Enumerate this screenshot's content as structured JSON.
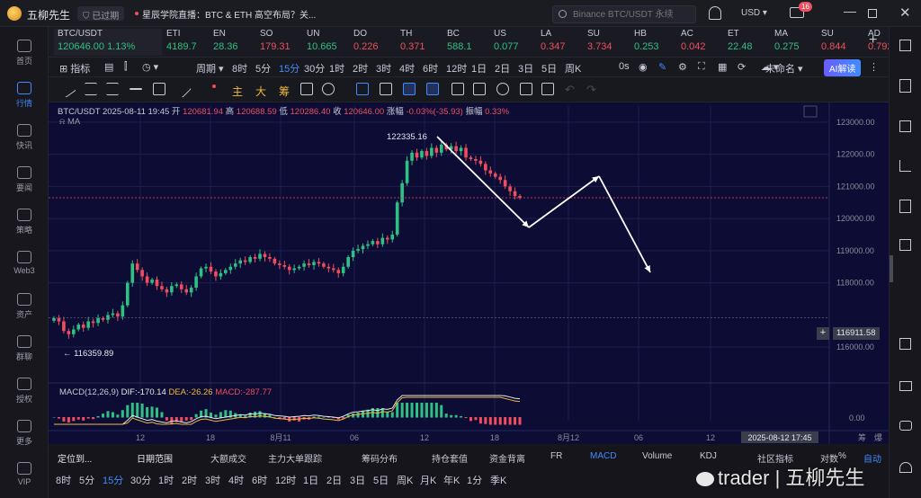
{
  "app": {
    "name": "五柳先生",
    "expired": "已过期",
    "news": "星辰学院直播：BTC & ETH 高空布局？关...",
    "search_placeholder": "Binance BTC/USDT 永续",
    "currency": "USD",
    "mail_badge": "16"
  },
  "nav": [
    {
      "label": "首页",
      "icon": "home-icon"
    },
    {
      "label": "行情",
      "icon": "chart-bars-icon",
      "active": true
    },
    {
      "label": "快讯",
      "icon": "news-icon"
    },
    {
      "label": "要闻",
      "icon": "paper-icon"
    },
    {
      "label": "策略",
      "icon": "strategy-icon"
    },
    {
      "label": "Web3",
      "icon": "web3-icon"
    },
    {
      "label": "资产",
      "icon": "wallet-icon"
    },
    {
      "label": "群聊",
      "icon": "chat-icon"
    },
    {
      "label": "授权",
      "icon": "key-icon"
    },
    {
      "label": "更多",
      "icon": "more-icon"
    },
    {
      "label": "VIP",
      "icon": "vip-icon"
    }
  ],
  "tickers": [
    {
      "sym": "BTC/USDT",
      "price": "120646.00",
      "chg": "1.13%",
      "dir": "up",
      "active": true
    },
    {
      "sym": "ETI",
      "price": "4189.7",
      "dir": "up"
    },
    {
      "sym": "EN",
      "price": "28.36",
      "dir": "up"
    },
    {
      "sym": "SO",
      "price": "179.31",
      "dir": "dn"
    },
    {
      "sym": "UN",
      "price": "10.665",
      "dir": "up"
    },
    {
      "sym": "DO",
      "price": "0.226",
      "dir": "dn"
    },
    {
      "sym": "TH",
      "price": "0.371",
      "dir": "dn"
    },
    {
      "sym": "BC",
      "price": "588.1",
      "dir": "up"
    },
    {
      "sym": "US",
      "price": "0.077",
      "dir": "up"
    },
    {
      "sym": "LA",
      "price": "0.347",
      "dir": "dn"
    },
    {
      "sym": "SU",
      "price": "3.734",
      "dir": "dn"
    },
    {
      "sym": "HB",
      "price": "0.253",
      "dir": "up"
    },
    {
      "sym": "AC",
      "price": "0.042",
      "dir": "dn"
    },
    {
      "sym": "ET",
      "price": "22.48",
      "dir": "up"
    },
    {
      "sym": "MA",
      "price": "0.275",
      "dir": "up"
    },
    {
      "sym": "SU",
      "price": "0.844",
      "dir": "dn"
    },
    {
      "sym": "AD",
      "price": "0.792",
      "dir": "dn"
    },
    {
      "sym": "LP",
      "price": "6.662",
      "dir": "up"
    }
  ],
  "toolbar1": {
    "indicator": "指标",
    "period": "周期",
    "intervals": [
      "8时",
      "5分",
      "15分",
      "30分",
      "1时",
      "2时",
      "3时",
      "4时",
      "6时",
      "12时",
      "1日",
      "2日",
      "3日",
      "5日",
      "周K"
    ],
    "active_interval": "15分",
    "right_interval": "0s",
    "unnamed": "未命名",
    "ai": "AI解读"
  },
  "toolbar2": {
    "draw_labels": [
      "主",
      "大",
      "筹"
    ]
  },
  "legend": {
    "title": "BTC/USDT 2025-08-11 19:45",
    "open_label": "开",
    "open": "120681.94",
    "high_label": "高",
    "high": "120688.59",
    "low_label": "低",
    "low": "120286.40",
    "close_label": "收",
    "close": "120646.00",
    "chg_label": "涨幅",
    "chg": "-0.03%(-35.93)",
    "amp_label": "振幅",
    "amp": "0.33%",
    "ma": "MA"
  },
  "macd": {
    "label": "MACD(12,26,9)",
    "dif": "DIF:-170.14",
    "dea": "DEA:-26.26",
    "macd": "MACD:-287.77",
    "zero": "0.00"
  },
  "chart_data": {
    "type": "candlestick",
    "y_ticks": [
      "123000.00",
      "122000.00",
      "121000.00",
      "120000.00",
      "119000.00",
      "118000.00",
      "116000.00"
    ],
    "ylim": [
      115500,
      123500
    ],
    "x_ticks": [
      "12",
      "18",
      "8月11",
      "06",
      "12",
      "18",
      "8月12",
      "06",
      "12"
    ],
    "high_annotation": "122335.16",
    "low_annotation": "116359.89",
    "current_price": "116911.58",
    "cursor_time": "2025-08-12 17:45",
    "closes": [
      116900,
      116800,
      116500,
      116400,
      116550,
      116700,
      116600,
      116800,
      116750,
      116900,
      116850,
      117000,
      117050,
      116950,
      117300,
      118000,
      118600,
      118400,
      118200,
      118000,
      118100,
      117900,
      117800,
      117700,
      117900,
      117950,
      117800,
      117700,
      117850,
      118200,
      118450,
      118500,
      118350,
      118200,
      118300,
      118400,
      118500,
      118600,
      118700,
      118650,
      118800,
      118750,
      118900,
      118800,
      118750,
      118600,
      118550,
      118500,
      118400,
      118450,
      118500,
      118600,
      118550,
      118650,
      118600,
      118500,
      118450,
      118400,
      118300,
      118500,
      118800,
      119000,
      119050,
      119150,
      119200,
      119300,
      119200,
      119400,
      119350,
      119500,
      120500,
      121100,
      121800,
      122050,
      121900,
      122100,
      121950,
      122200,
      122050,
      122300,
      122150,
      122250,
      122100,
      122200,
      121900,
      121850,
      121800,
      121700,
      121500,
      121400,
      121300,
      121200,
      121000,
      120850,
      120700,
      120646
    ],
    "projection": [
      [
        122335,
        0
      ],
      [
        119950,
        6
      ],
      [
        121300,
        16
      ],
      [
        118800,
        22
      ]
    ],
    "ylabels_right": [
      "筹",
      "爆"
    ]
  },
  "bottom": {
    "tabs1": [
      "定位到...",
      "日期范围"
    ],
    "tabs2": [
      "大额成交",
      "主力大单跟踪",
      "筹码分布",
      "持仓套值",
      "资金背离",
      "FR",
      "MACD",
      "Volume",
      "KDJ"
    ],
    "active_tab": "MACD",
    "right": [
      "社区指标",
      "对数",
      "%",
      "自动"
    ],
    "intervals": [
      "8时",
      "5分",
      "15分",
      "30分",
      "1时",
      "2时",
      "3时",
      "4时",
      "6时",
      "12时",
      "1日",
      "2日",
      "3日",
      "5日",
      "周K",
      "月K",
      "年K",
      "1分",
      "季K"
    ],
    "active_interval": "15分"
  },
  "watermark": "trader | 五柳先生"
}
